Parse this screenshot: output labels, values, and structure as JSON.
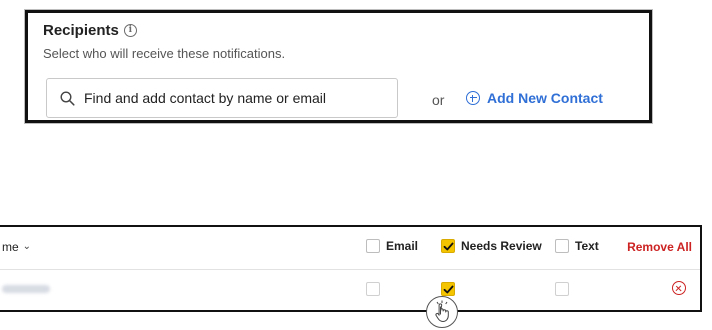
{
  "recipients": {
    "title": "Recipients",
    "subtitle": "Select who will receive these notifications.",
    "search_text": "Find and add contact by name or email",
    "or_text": "or",
    "add_new_contact_label": "Add New Contact",
    "accent_color": "#2f6fd6"
  },
  "table": {
    "name_header": "me",
    "columns": [
      {
        "label": "Email",
        "checked": false
      },
      {
        "label": "Needs Review",
        "checked": true
      },
      {
        "label": "Text",
        "checked": false
      }
    ],
    "remove_all_label": "Remove All",
    "rows": [
      {
        "email": false,
        "needs_review": true,
        "text": false
      }
    ],
    "check_color": "#f5c400",
    "remove_color": "#cc2222"
  },
  "icons": [
    "info-icon",
    "search-icon",
    "plus-circle-icon",
    "chevron-down-icon",
    "remove-circle-icon",
    "pointer-hand-icon"
  ]
}
